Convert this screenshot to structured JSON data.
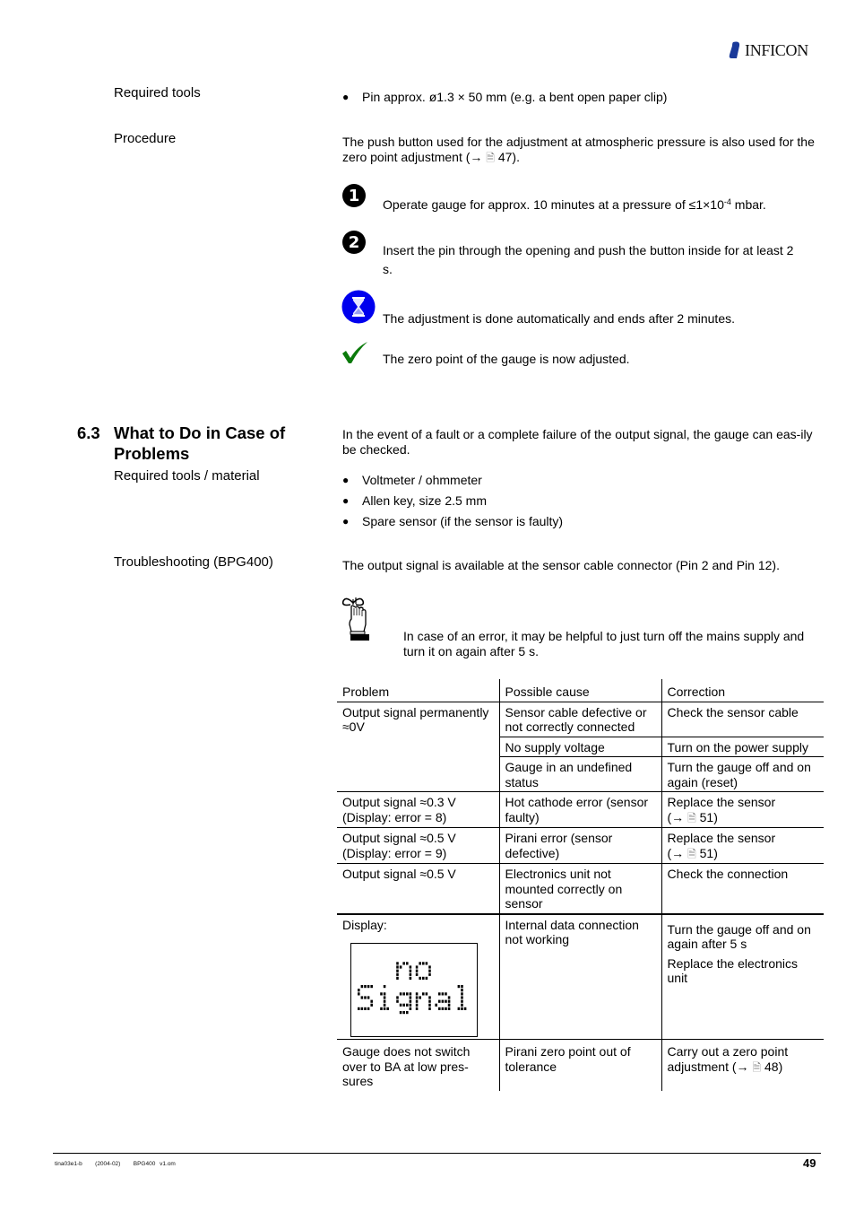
{
  "header": {
    "brand": "INFICON"
  },
  "zero_adjust": {
    "required_tools_label": "Required tools",
    "required_tools": [
      "Pin approx. ø1.3 × 50 mm (e.g. a bent open paper clip)"
    ],
    "procedure_label": "Procedure",
    "procedure_intro": "The push button used for the adjustment at atmospheric pressure is also used for the zero point adjustment (→ ",
    "procedure_intro_page": "47",
    "procedure_intro_end": ").",
    "steps": [
      {
        "number": "1",
        "text_before": "Operate gauge for approx. 10 minutes at a pressure of ≤1×10",
        "sup": "-4",
        "text_after": " mbar."
      },
      {
        "number": "2",
        "text": "Insert the pin through the opening and push the button inside for at least 2 s."
      }
    ],
    "wait_text": "The adjustment is done automatically and ends after 2 minutes.",
    "result_text": "The zero point of the gauge is now adjusted."
  },
  "section": {
    "number": "6.3",
    "title": "What to Do in Case of Problems",
    "intro": "In the event of a fault or a complete failure of the output signal, the gauge can eas-ily be checked.",
    "required_label": "Required tools / material",
    "required_items": [
      "Voltmeter / ohmmeter",
      "Allen key, size 2.5 mm",
      "Spare sensor (if the sensor is faulty)"
    ],
    "troubleshooting_label": "Troubleshooting (BPG400)",
    "troubleshooting_intro": "The output signal is available at the sensor cable connector (Pin 2 and Pin 12).",
    "note": "In case of an error, it may be helpful to just turn off the mains supply and turn it on again after 5 s."
  },
  "table": {
    "headers": [
      "Problem",
      "Possible cause",
      "Correction"
    ],
    "rows": [
      {
        "problem": "Output signal permanently ≈0V",
        "cause": "Sensor cable defective or not correctly connected",
        "correction": "Check the sensor cable"
      },
      {
        "problem": "",
        "cause": "No supply voltage",
        "correction": "Turn on the power supply"
      },
      {
        "problem": "",
        "cause": "Gauge in an undefined status",
        "correction": "Turn the gauge off and on again (reset)"
      },
      {
        "problem": "Output signal ≈0.3 V (Display: error = 8)",
        "cause": "Hot cathode error (sensor faulty)",
        "correction": "Replace the sensor",
        "correction_ref": "51"
      },
      {
        "problem": "Output signal ≈0.5 V (Display: error = 9)",
        "cause": "Pirani error (sensor defective)",
        "correction": "Replace the sensor",
        "correction_ref": "51"
      },
      {
        "problem": "Output signal ≈0.5 V",
        "cause": "Electronics unit not mounted correctly on sensor",
        "correction": "Check the connection"
      },
      {
        "problem": "Display:",
        "display_lines": [
          "no",
          "Signal"
        ],
        "cause": "Internal data connection not working",
        "correction": "Turn the gauge off and on again after 5 s",
        "correction2": "Replace the electronics unit"
      },
      {
        "problem": "Gauge does not switch over to BA at low pres-sures",
        "cause": "Pirani zero point out of tolerance",
        "correction": "Carry out a zero point adjustment (→ ",
        "correction_ref": "48"
      }
    ]
  },
  "footer": {
    "doc_id": "tina03e1-b",
    "date": "(2004-02)",
    "file": "BPG400 v1.om",
    "page": "49"
  },
  "colors": {
    "hourglass_blue": "#0000ee",
    "check_green": "#0a7a0a"
  }
}
